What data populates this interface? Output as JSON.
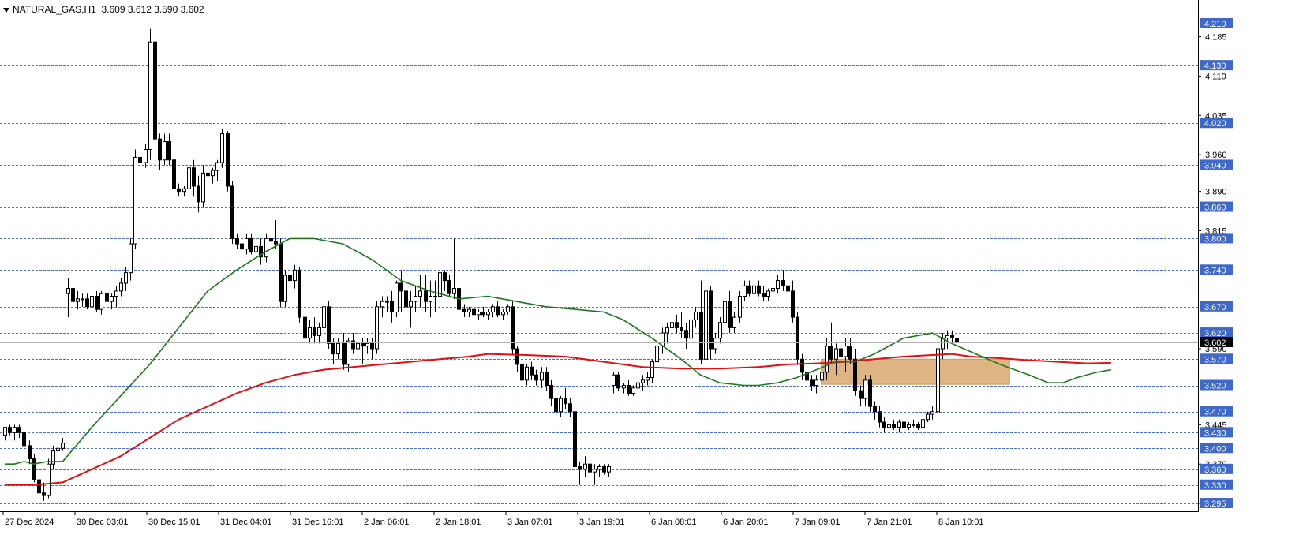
{
  "header": {
    "symbol": "NATURAL_GAS,H1",
    "ohlc": "3.609 3.612 3.590 3.602"
  },
  "colors": {
    "candle_up": "#ffffff",
    "candle_down": "#000000",
    "grid": "#4a6fd1",
    "ma_fast": "#1a7a1a",
    "ma_slow": "#e01010",
    "zone": "#deb483",
    "level_tag_bg": "#3e68c9",
    "current_tag_bg": "#000000"
  },
  "chart_data": {
    "type": "candlestick",
    "y_range": [
      3.28,
      4.225
    ],
    "axis_ticks": [
      "4.185",
      "4.110",
      "4.035",
      "3.960",
      "3.890",
      "3.815",
      "3.590",
      "3.445",
      "3.370",
      "3.295"
    ],
    "levels": [
      "4.210",
      "4.130",
      "4.020",
      "3.940",
      "3.860",
      "3.800",
      "3.740",
      "3.670",
      "3.620",
      "3.570",
      "3.520",
      "3.470",
      "3.430",
      "3.400",
      "3.360",
      "3.330",
      "3.295"
    ],
    "current_price": "3.602",
    "time_labels": [
      "27 Dec 2024",
      "30 Dec 03:01",
      "30 Dec 15:01",
      "31 Dec 04:01",
      "31 Dec 16:01",
      "2 Jan 06:01",
      "2 Jan 18:01",
      "3 Jan 07:01",
      "3 Jan 19:01",
      "6 Jan 08:01",
      "6 Jan 20:01",
      "7 Jan 09:01",
      "7 Jan 21:01",
      "8 Jan 10:01"
    ],
    "zone": {
      "bar_start": 169,
      "bar_end": 208,
      "top": 3.57,
      "bottom": 3.522
    },
    "candles": [
      [
        3.425,
        3.44,
        3.415,
        3.44
      ],
      [
        3.44,
        3.445,
        3.425,
        3.43
      ],
      [
        3.43,
        3.445,
        3.415,
        3.44
      ],
      [
        3.44,
        3.445,
        3.42,
        3.43
      ],
      [
        3.43,
        3.445,
        3.4,
        3.405
      ],
      [
        3.405,
        3.415,
        3.37,
        3.38
      ],
      [
        3.38,
        3.39,
        3.335,
        3.34
      ],
      [
        3.34,
        3.35,
        3.305,
        3.315
      ],
      [
        3.315,
        3.335,
        3.3,
        3.31
      ],
      [
        3.31,
        3.38,
        3.305,
        3.37
      ],
      [
        3.37,
        3.405,
        3.36,
        3.395
      ],
      [
        3.395,
        3.405,
        3.38,
        3.4
      ],
      [
        3.4,
        3.42,
        3.395,
        3.41
      ],
      [
        3.695,
        3.725,
        3.65,
        3.705
      ],
      [
        3.705,
        3.72,
        3.67,
        3.68
      ],
      [
        3.68,
        3.7,
        3.665,
        3.685
      ],
      [
        3.685,
        3.695,
        3.67,
        3.685
      ],
      [
        3.685,
        3.695,
        3.665,
        3.67
      ],
      [
        3.67,
        3.69,
        3.66,
        3.69
      ],
      [
        3.69,
        3.7,
        3.66,
        3.665
      ],
      [
        3.665,
        3.7,
        3.655,
        3.695
      ],
      [
        3.695,
        3.71,
        3.67,
        3.68
      ],
      [
        3.68,
        3.695,
        3.665,
        3.69
      ],
      [
        3.69,
        3.71,
        3.67,
        3.7
      ],
      [
        3.7,
        3.725,
        3.69,
        3.715
      ],
      [
        3.715,
        3.745,
        3.7,
        3.735
      ],
      [
        3.735,
        3.8,
        3.72,
        3.79
      ],
      [
        3.79,
        3.97,
        3.78,
        3.955
      ],
      [
        3.955,
        3.98,
        3.93,
        3.945
      ],
      [
        3.945,
        3.98,
        3.935,
        3.97
      ],
      [
        3.97,
        4.2,
        3.95,
        4.175
      ],
      [
        4.175,
        4.18,
        3.93,
        3.99
      ],
      [
        3.99,
        4.0,
        3.93,
        3.95
      ],
      [
        3.95,
        4.0,
        3.94,
        3.985
      ],
      [
        3.985,
        4.0,
        3.94,
        3.95
      ],
      [
        3.95,
        3.96,
        3.85,
        3.895
      ],
      [
        3.895,
        3.905,
        3.88,
        3.89
      ],
      [
        3.89,
        3.9,
        3.88,
        3.895
      ],
      [
        3.895,
        3.94,
        3.89,
        3.935
      ],
      [
        3.935,
        3.95,
        3.88,
        3.9
      ],
      [
        3.9,
        3.92,
        3.85,
        3.87
      ],
      [
        3.87,
        3.94,
        3.86,
        3.925
      ],
      [
        3.925,
        3.94,
        3.91,
        3.92
      ],
      [
        3.92,
        3.935,
        3.905,
        3.93
      ],
      [
        3.93,
        3.95,
        3.91,
        3.945
      ],
      [
        3.945,
        4.01,
        3.935,
        4.0
      ],
      [
        4.0,
        4.005,
        3.89,
        3.9
      ],
      [
        3.9,
        3.91,
        3.79,
        3.8
      ],
      [
        3.8,
        3.81,
        3.78,
        3.79
      ],
      [
        3.79,
        3.8,
        3.77,
        3.78
      ],
      [
        3.78,
        3.81,
        3.77,
        3.8
      ],
      [
        3.8,
        3.81,
        3.77,
        3.775
      ],
      [
        3.775,
        3.79,
        3.76,
        3.785
      ],
      [
        3.785,
        3.8,
        3.75,
        3.765
      ],
      [
        3.765,
        3.81,
        3.755,
        3.8
      ],
      [
        3.8,
        3.82,
        3.79,
        3.795
      ],
      [
        3.795,
        3.835,
        3.78,
        3.79
      ],
      [
        3.79,
        3.8,
        3.67,
        3.68
      ],
      [
        3.68,
        3.74,
        3.67,
        3.73
      ],
      [
        3.73,
        3.76,
        3.7,
        3.72
      ],
      [
        3.72,
        3.75,
        3.705,
        3.74
      ],
      [
        3.74,
        3.745,
        3.64,
        3.65
      ],
      [
        3.65,
        3.66,
        3.59,
        3.61
      ],
      [
        3.61,
        3.645,
        3.6,
        3.63
      ],
      [
        3.63,
        3.65,
        3.6,
        3.615
      ],
      [
        3.615,
        3.64,
        3.6,
        3.63
      ],
      [
        3.63,
        3.68,
        3.62,
        3.67
      ],
      [
        3.67,
        3.68,
        3.59,
        3.6
      ],
      [
        3.6,
        3.61,
        3.56,
        3.58
      ],
      [
        3.58,
        3.61,
        3.57,
        3.6
      ],
      [
        3.6,
        3.62,
        3.55,
        3.56
      ],
      [
        3.56,
        3.61,
        3.545,
        3.605
      ],
      [
        3.605,
        3.62,
        3.58,
        3.59
      ],
      [
        3.59,
        3.61,
        3.57,
        3.6
      ],
      [
        3.6,
        3.61,
        3.56,
        3.595
      ],
      [
        3.595,
        3.61,
        3.58,
        3.6
      ],
      [
        3.6,
        3.61,
        3.57,
        3.59
      ],
      [
        3.59,
        3.68,
        3.58,
        3.67
      ],
      [
        3.67,
        3.69,
        3.65,
        3.68
      ],
      [
        3.68,
        3.69,
        3.66,
        3.68
      ],
      [
        3.68,
        3.7,
        3.64,
        3.66
      ],
      [
        3.66,
        3.72,
        3.65,
        3.715
      ],
      [
        3.715,
        3.74,
        3.66,
        3.7
      ],
      [
        3.7,
        3.72,
        3.66,
        3.67
      ],
      [
        3.67,
        3.7,
        3.63,
        3.68
      ],
      [
        3.68,
        3.71,
        3.66,
        3.69
      ],
      [
        3.69,
        3.73,
        3.67,
        3.7
      ],
      [
        3.7,
        3.73,
        3.66,
        3.68
      ],
      [
        3.68,
        3.72,
        3.65,
        3.69
      ],
      [
        3.69,
        3.72,
        3.66,
        3.69
      ],
      [
        3.69,
        3.745,
        3.68,
        3.735
      ],
      [
        3.735,
        3.74,
        3.7,
        3.72
      ],
      [
        3.72,
        3.73,
        3.69,
        3.695
      ],
      [
        3.695,
        3.8,
        3.685,
        3.705
      ],
      [
        3.705,
        3.71,
        3.65,
        3.665
      ],
      [
        3.665,
        3.675,
        3.65,
        3.66
      ],
      [
        3.66,
        3.67,
        3.65,
        3.665
      ],
      [
        3.665,
        3.67,
        3.65,
        3.655
      ],
      [
        3.655,
        3.665,
        3.645,
        3.66
      ],
      [
        3.66,
        3.67,
        3.65,
        3.655
      ],
      [
        3.655,
        3.665,
        3.645,
        3.66
      ],
      [
        3.66,
        3.675,
        3.65,
        3.67
      ],
      [
        3.67,
        3.68,
        3.65,
        3.655
      ],
      [
        3.655,
        3.665,
        3.645,
        3.66
      ],
      [
        3.66,
        3.675,
        3.655,
        3.67
      ],
      [
        3.67,
        3.68,
        3.58,
        3.59
      ],
      [
        3.59,
        3.595,
        3.545,
        3.56
      ],
      [
        3.56,
        3.57,
        3.52,
        3.53
      ],
      [
        3.53,
        3.56,
        3.52,
        3.555
      ],
      [
        3.555,
        3.565,
        3.53,
        3.54
      ],
      [
        3.54,
        3.55,
        3.52,
        3.53
      ],
      [
        3.53,
        3.555,
        3.515,
        3.545
      ],
      [
        3.545,
        3.555,
        3.51,
        3.52
      ],
      [
        3.52,
        3.53,
        3.48,
        3.495
      ],
      [
        3.495,
        3.505,
        3.46,
        3.47
      ],
      [
        3.47,
        3.5,
        3.46,
        3.495
      ],
      [
        3.495,
        3.515,
        3.475,
        3.485
      ],
      [
        3.485,
        3.495,
        3.46,
        3.47
      ],
      [
        3.47,
        3.48,
        3.35,
        3.365
      ],
      [
        3.365,
        3.375,
        3.33,
        3.36
      ],
      [
        3.36,
        3.385,
        3.345,
        3.37
      ],
      [
        3.37,
        3.38,
        3.34,
        3.355
      ],
      [
        3.355,
        3.37,
        3.33,
        3.36
      ],
      [
        3.36,
        3.37,
        3.345,
        3.365
      ],
      [
        3.365,
        3.37,
        3.35,
        3.355
      ],
      [
        3.355,
        3.37,
        3.345,
        3.365
      ],
      [
        3.52,
        3.545,
        3.505,
        3.54
      ],
      [
        3.54,
        3.545,
        3.51,
        3.515
      ],
      [
        3.515,
        3.525,
        3.505,
        3.52
      ],
      [
        3.52,
        3.53,
        3.5,
        3.505
      ],
      [
        3.505,
        3.52,
        3.5,
        3.515
      ],
      [
        3.515,
        3.53,
        3.505,
        3.525
      ],
      [
        3.525,
        3.54,
        3.51,
        3.53
      ],
      [
        3.53,
        3.545,
        3.52,
        3.535
      ],
      [
        3.535,
        3.57,
        3.525,
        3.565
      ],
      [
        3.565,
        3.6,
        3.555,
        3.595
      ],
      [
        3.595,
        3.63,
        3.58,
        3.62
      ],
      [
        3.62,
        3.64,
        3.6,
        3.63
      ],
      [
        3.63,
        3.65,
        3.61,
        3.64
      ],
      [
        3.64,
        3.655,
        3.62,
        3.63
      ],
      [
        3.63,
        3.66,
        3.61,
        3.625
      ],
      [
        3.625,
        3.64,
        3.59,
        3.61
      ],
      [
        3.61,
        3.65,
        3.6,
        3.645
      ],
      [
        3.645,
        3.67,
        3.63,
        3.66
      ],
      [
        3.66,
        3.72,
        3.56,
        3.57
      ],
      [
        3.57,
        3.715,
        3.56,
        3.7
      ],
      [
        3.7,
        3.71,
        3.57,
        3.59
      ],
      [
        3.59,
        3.62,
        3.58,
        3.61
      ],
      [
        3.61,
        3.65,
        3.6,
        3.64
      ],
      [
        3.64,
        3.69,
        3.63,
        3.68
      ],
      [
        3.68,
        3.7,
        3.62,
        3.63
      ],
      [
        3.63,
        3.66,
        3.62,
        3.65
      ],
      [
        3.65,
        3.7,
        3.64,
        3.69
      ],
      [
        3.69,
        3.72,
        3.68,
        3.71
      ],
      [
        3.71,
        3.72,
        3.69,
        3.695
      ],
      [
        3.695,
        3.715,
        3.69,
        3.71
      ],
      [
        3.71,
        3.72,
        3.69,
        3.695
      ],
      [
        3.695,
        3.71,
        3.68,
        3.69
      ],
      [
        3.69,
        3.705,
        3.68,
        3.7
      ],
      [
        3.7,
        3.71,
        3.69,
        3.705
      ],
      [
        3.705,
        3.73,
        3.695,
        3.72
      ],
      [
        3.72,
        3.74,
        3.7,
        3.71
      ],
      [
        3.71,
        3.73,
        3.69,
        3.7
      ],
      [
        3.7,
        3.72,
        3.64,
        3.65
      ],
      [
        3.65,
        3.66,
        3.56,
        3.57
      ],
      [
        3.57,
        3.58,
        3.53,
        3.545
      ],
      [
        3.545,
        3.56,
        3.52,
        3.53
      ],
      [
        3.53,
        3.54,
        3.51,
        3.52
      ],
      [
        3.52,
        3.54,
        3.505,
        3.53
      ],
      [
        3.53,
        3.56,
        3.51,
        3.545
      ],
      [
        3.545,
        3.61,
        3.53,
        3.595
      ],
      [
        3.595,
        3.64,
        3.56,
        3.57
      ],
      [
        3.57,
        3.6,
        3.54,
        3.59
      ],
      [
        3.59,
        3.62,
        3.56,
        3.575
      ],
      [
        3.575,
        3.61,
        3.545,
        3.595
      ],
      [
        3.595,
        3.61,
        3.56,
        3.57
      ],
      [
        3.57,
        3.59,
        3.5,
        3.51
      ],
      [
        3.51,
        3.52,
        3.48,
        3.495
      ],
      [
        3.495,
        3.54,
        3.48,
        3.53
      ],
      [
        3.53,
        3.54,
        3.47,
        3.48
      ],
      [
        3.48,
        3.49,
        3.455,
        3.47
      ],
      [
        3.47,
        3.48,
        3.44,
        3.45
      ],
      [
        3.45,
        3.46,
        3.43,
        3.44
      ],
      [
        3.44,
        3.45,
        3.43,
        3.445
      ],
      [
        3.445,
        3.455,
        3.435,
        3.44
      ],
      [
        3.44,
        3.455,
        3.43,
        3.45
      ],
      [
        3.45,
        3.455,
        3.435,
        3.44
      ],
      [
        3.44,
        3.45,
        3.435,
        3.445
      ],
      [
        3.445,
        3.455,
        3.44,
        3.445
      ],
      [
        3.445,
        3.45,
        3.435,
        3.44
      ],
      [
        3.44,
        3.46,
        3.435,
        3.455
      ],
      [
        3.455,
        3.47,
        3.45,
        3.465
      ],
      [
        3.465,
        3.48,
        3.455,
        3.47
      ],
      [
        3.47,
        3.6,
        3.465,
        3.59
      ],
      [
        3.59,
        3.62,
        3.57,
        3.61
      ],
      [
        3.61,
        3.625,
        3.59,
        3.615
      ],
      [
        3.615,
        3.625,
        3.6,
        3.612
      ],
      [
        3.609,
        3.612,
        3.59,
        3.602
      ]
    ],
    "ma_fast": [
      [
        0,
        3.37
      ],
      [
        2,
        3.37
      ],
      [
        4,
        3.375
      ],
      [
        6,
        3.37
      ],
      [
        9,
        3.375
      ],
      [
        12,
        3.375
      ],
      [
        18,
        3.44
      ],
      [
        24,
        3.5
      ],
      [
        30,
        3.56
      ],
      [
        36,
        3.63
      ],
      [
        42,
        3.7
      ],
      [
        48,
        3.74
      ],
      [
        54,
        3.775
      ],
      [
        59,
        3.8
      ],
      [
        64,
        3.8
      ],
      [
        70,
        3.79
      ],
      [
        76,
        3.76
      ],
      [
        82,
        3.72
      ],
      [
        88,
        3.7
      ],
      [
        94,
        3.685
      ],
      [
        100,
        3.69
      ],
      [
        106,
        3.68
      ],
      [
        112,
        3.67
      ],
      [
        118,
        3.665
      ],
      [
        124,
        3.66
      ],
      [
        128,
        3.645
      ],
      [
        134,
        3.61
      ],
      [
        140,
        3.57
      ],
      [
        144,
        3.54
      ],
      [
        148,
        3.525
      ],
      [
        153,
        3.52
      ],
      [
        156,
        3.52
      ],
      [
        160,
        3.525
      ],
      [
        164,
        3.535
      ],
      [
        168,
        3.55
      ],
      [
        172,
        3.565
      ],
      [
        176,
        3.565
      ],
      [
        180,
        3.58
      ],
      [
        186,
        3.61
      ],
      [
        192,
        3.62
      ],
      [
        196,
        3.6
      ],
      [
        201,
        3.58
      ],
      [
        206,
        3.56
      ],
      [
        212,
        3.54
      ],
      [
        216,
        3.525
      ],
      [
        219,
        3.525
      ],
      [
        222,
        3.535
      ],
      [
        226,
        3.545
      ],
      [
        229,
        3.55
      ]
    ],
    "ma_slow": [
      [
        0,
        3.33
      ],
      [
        6,
        3.33
      ],
      [
        12,
        3.335
      ],
      [
        18,
        3.36
      ],
      [
        24,
        3.385
      ],
      [
        30,
        3.42
      ],
      [
        36,
        3.455
      ],
      [
        42,
        3.48
      ],
      [
        48,
        3.505
      ],
      [
        54,
        3.525
      ],
      [
        60,
        3.54
      ],
      [
        66,
        3.55
      ],
      [
        72,
        3.555
      ],
      [
        78,
        3.56
      ],
      [
        84,
        3.565
      ],
      [
        90,
        3.57
      ],
      [
        96,
        3.575
      ],
      [
        100,
        3.58
      ],
      [
        108,
        3.578
      ],
      [
        116,
        3.575
      ],
      [
        124,
        3.565
      ],
      [
        132,
        3.555
      ],
      [
        140,
        3.552
      ],
      [
        148,
        3.552
      ],
      [
        156,
        3.555
      ],
      [
        162,
        3.56
      ],
      [
        168,
        3.562
      ],
      [
        174,
        3.565
      ],
      [
        180,
        3.57
      ],
      [
        186,
        3.575
      ],
      [
        192,
        3.578
      ],
      [
        196,
        3.58
      ],
      [
        200,
        3.575
      ],
      [
        206,
        3.572
      ],
      [
        212,
        3.568
      ],
      [
        218,
        3.565
      ],
      [
        224,
        3.562
      ],
      [
        229,
        3.563
      ]
    ]
  }
}
